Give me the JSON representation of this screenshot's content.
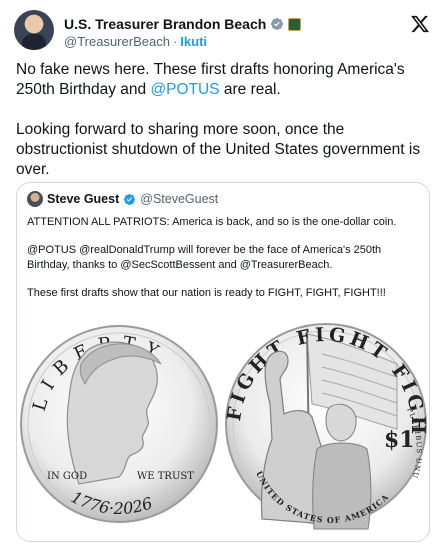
{
  "author": {
    "name": "U.S. Treasurer Brandon Beach",
    "handle": "@TreasurerBeach",
    "separator": "·",
    "follow_label": "Ikuti",
    "avatar_icon": "profile-photo",
    "verified_icon": "verified-badge-icon",
    "org_badge_icon": "government-badge-icon"
  },
  "platform_icon": "x-logo-icon",
  "tweet": {
    "p1_before": "No fake news here. These first drafts honoring America's 250th Birthday and ",
    "p1_mention": "@POTUS",
    "p1_after": " are real.",
    "p2": "Looking forward to sharing more soon, once the obstructionist shutdown of the United States government is over."
  },
  "quote": {
    "name": "Steve Guest",
    "handle": "@SteveGuest",
    "p1": "ATTENTION ALL PATRIOTS: America is back, and so is the one-dollar coin.",
    "p2": "@POTUS @realDonaldTrump will forever be the face of America's 250th Birthday, thanks to @SecScottBessent and @TreasurerBeach.",
    "p3": "These first drafts show that our nation is ready to FIGHT, FIGHT, FIGHT!!!"
  },
  "coin_front": {
    "top_text": "LIBERTY",
    "motto_left": "IN GOD",
    "motto_right": "WE TRUST",
    "years": "1776·2026"
  },
  "coin_back": {
    "top_text": "FIGHT FIGHT FIGHT",
    "denomination": "$1",
    "bottom_text": "UNITED STATES OF AMERICA",
    "right_text": "PLURIBUS UNUM"
  },
  "colors": {
    "link": "#1d9bf0",
    "secondary_text": "#536471",
    "border": "#cfd9de"
  }
}
